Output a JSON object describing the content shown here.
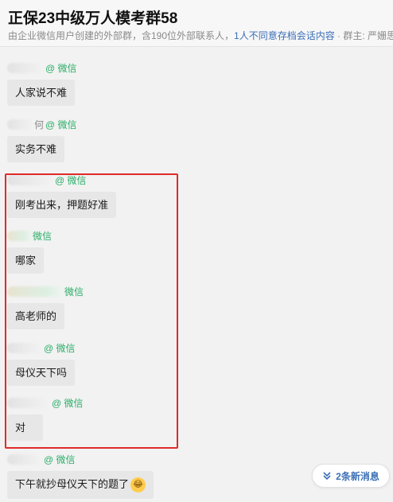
{
  "header": {
    "title": "正保23中级万人模考群58",
    "subtitle_prefix": "由企业微信用户创建的外部群，含190位外部联系人，",
    "subtitle_link": "1人不同意存档会话内容",
    "subtitle_suffix": " · 群主: 严姗思"
  },
  "messages": [
    {
      "sender_suffix": "",
      "source": "@ 微信",
      "text": "人家说不难"
    },
    {
      "sender_suffix": "何",
      "source": "@ 微信",
      "text": "实务不难"
    },
    {
      "sender_suffix": "",
      "source": "@ 微信",
      "text": "刚考出来，押题好准"
    },
    {
      "sender_suffix": "",
      "source": "微信",
      "text": "哪家"
    },
    {
      "sender_suffix": "",
      "source": "微信",
      "text": "高老师的"
    },
    {
      "sender_suffix": "",
      "source": "@ 微信",
      "text": "母仪天下吗"
    },
    {
      "sender_suffix": "",
      "source": "@ 微信",
      "text": "对"
    },
    {
      "sender_suffix": "",
      "source": "@ 微信",
      "text": "下午就抄母仪天下的题了"
    }
  ],
  "new_messages": {
    "label": "2条新消息",
    "icon": "double-chevron-down-icon"
  },
  "colors": {
    "source_green": "#2aae67",
    "highlight_red": "#e02a2a",
    "link_blue": "#3b6fb6"
  }
}
